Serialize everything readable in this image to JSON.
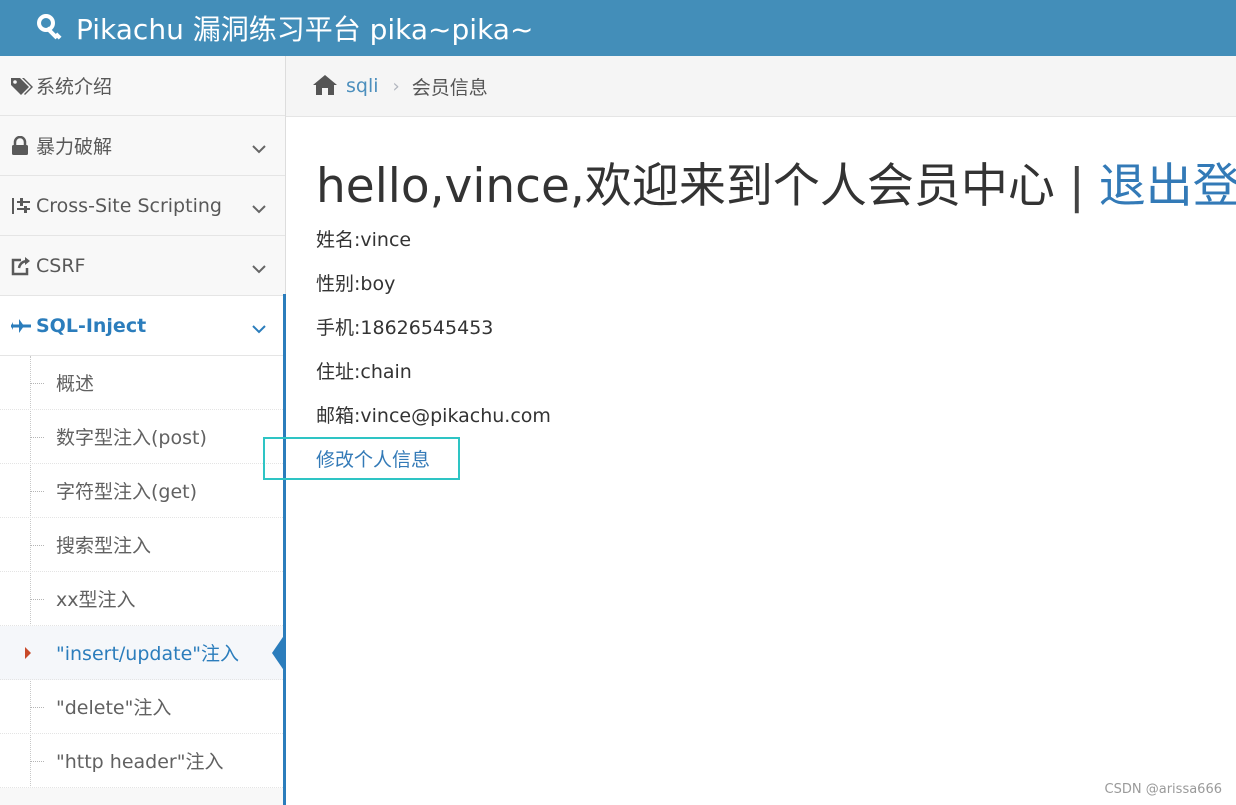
{
  "header": {
    "title": "Pikachu 漏洞练习平台 pika~pika~",
    "icon": "key-icon"
  },
  "sidebar": {
    "items": [
      {
        "label": "系统介绍",
        "icon": "tags-icon",
        "has_chevron": false
      },
      {
        "label": "暴力破解",
        "icon": "lock-icon",
        "has_chevron": true
      },
      {
        "label": "Cross-Site Scripting",
        "icon": "sliders-icon",
        "has_chevron": true
      },
      {
        "label": "CSRF",
        "icon": "share-square-icon",
        "has_chevron": true
      },
      {
        "label": "SQL-Inject",
        "icon": "plane-icon",
        "has_chevron": true,
        "active": true
      }
    ],
    "submenu": [
      {
        "label": "概述"
      },
      {
        "label": "数字型注入(post)"
      },
      {
        "label": "字符型注入(get)"
      },
      {
        "label": "搜索型注入"
      },
      {
        "label": "xx型注入"
      },
      {
        "label": "\"insert/update\"注入",
        "current": true
      },
      {
        "label": "\"delete\"注入"
      },
      {
        "label": "\"http header\"注入"
      }
    ]
  },
  "breadcrumb": {
    "home_icon": "home-icon",
    "link": "sqli",
    "separator": "›",
    "current": "会员信息"
  },
  "main": {
    "welcome": "hello,vince,欢迎来到个人会员中心",
    "divider": "|",
    "logout": "退出登录",
    "fields": [
      "姓名:vince",
      "性别:boy",
      "手机:18626545453",
      "住址:chain",
      "邮箱:vince@pikachu.com"
    ],
    "edit_link": "修改个人信息"
  },
  "watermark": "CSDN @arissa666",
  "colors": {
    "header_bg": "#438eb9",
    "accent": "#2b7dbc",
    "link": "#337ab7",
    "highlight": "#2ec4c4"
  }
}
